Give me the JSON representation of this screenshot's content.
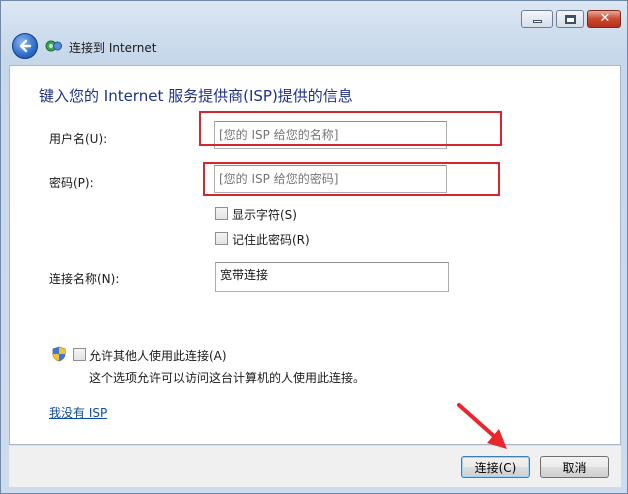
{
  "window": {
    "nav_title": "连接到 Internet",
    "close_glyph": "✕"
  },
  "main": {
    "heading": "键入您的 Internet 服务提供商(ISP)提供的信息",
    "username": {
      "label": "用户名(U):",
      "placeholder": "[您的 ISP 给您的名称]",
      "value": ""
    },
    "password": {
      "label": "密码(P):",
      "placeholder": "[您的 ISP 给您的密码]",
      "value": ""
    },
    "show_chars": {
      "label": "显示字符(S)",
      "checked": false
    },
    "remember_password": {
      "label": "记住此密码(R)",
      "checked": false
    },
    "connection_name": {
      "label": "连接名称(N):",
      "value": "宽带连接"
    },
    "allow_others": {
      "label": "允许其他人使用此连接(A)",
      "description": "这个选项允许可以访问这台计算机的人使用此连接。",
      "checked": false
    },
    "no_isp_link": "我没有 ISP"
  },
  "footer": {
    "connect_label": "连接(C)",
    "cancel_label": "取消"
  },
  "colors": {
    "heading": "#1e3287",
    "highlight_box": "#d6262f",
    "link": "#0c4c9c"
  }
}
